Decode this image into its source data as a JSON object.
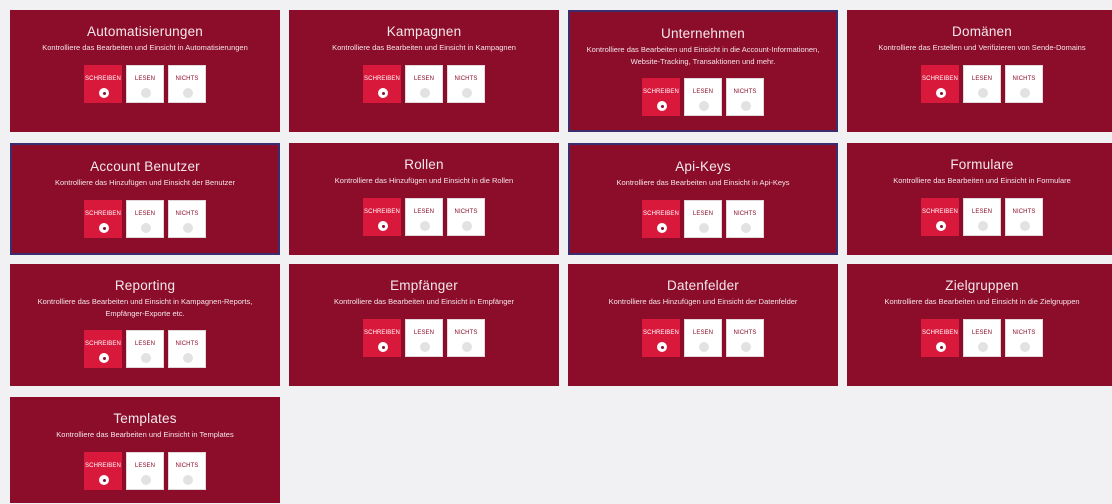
{
  "option_labels": {
    "write": "SCHREIBEN",
    "read": "LESEN",
    "none": "NICHTS"
  },
  "colors": {
    "card": "#8b0d2a",
    "active": "#d8193c",
    "background": "#f1f1f4"
  },
  "cards": [
    {
      "title": "Automatisierungen",
      "desc": "Kontrolliere das Bearbeiten und Einsicht in Automatisierungen",
      "selected": "write"
    },
    {
      "title": "Kampagnen",
      "desc": "Kontrolliere das Bearbeiten und Einsicht in Kampagnen",
      "selected": "write"
    },
    {
      "title": "Unternehmen",
      "desc": "Kontrolliere das Bearbeiten und Einsicht in die Account-Informationen, Website-Tracking, Transaktionen und mehr.",
      "selected": "write"
    },
    {
      "title": "Domänen",
      "desc": "Kontrolliere das Erstellen und Verifizieren von Sende-Domains",
      "selected": "write"
    },
    {
      "title": "Account Benutzer",
      "desc": "Kontrolliere das Hinzufügen und Einsicht der Benutzer",
      "selected": "write"
    },
    {
      "title": "Rollen",
      "desc": "Kontrolliere das Hinzufügen und Einsicht in die Rollen",
      "selected": "write"
    },
    {
      "title": "Api-Keys",
      "desc": "Kontrolliere das Bearbeiten und Einsicht in Api-Keys",
      "selected": "write"
    },
    {
      "title": "Formulare",
      "desc": "Kontrolliere das Bearbeiten und Einsicht in Formulare",
      "selected": "write"
    },
    {
      "title": "Reporting",
      "desc": "Kontrolliere das Bearbeiten und Einsicht in Kampagnen-Reports, Empfänger-Exporte etc.",
      "selected": "write"
    },
    {
      "title": "Empfänger",
      "desc": "Kontrolliere das Bearbeiten und Einsicht in Empfänger",
      "selected": "write"
    },
    {
      "title": "Datenfelder",
      "desc": "Kontrolliere das Hinzufügen und Einsicht der Datenfelder",
      "selected": "write"
    },
    {
      "title": "Zielgruppen",
      "desc": "Kontrolliere das Bearbeiten und Einsicht in die Zielgruppen",
      "selected": "write"
    },
    {
      "title": "Templates",
      "desc": "Kontrolliere das Bearbeiten und Einsicht in Templates",
      "selected": "write"
    }
  ]
}
